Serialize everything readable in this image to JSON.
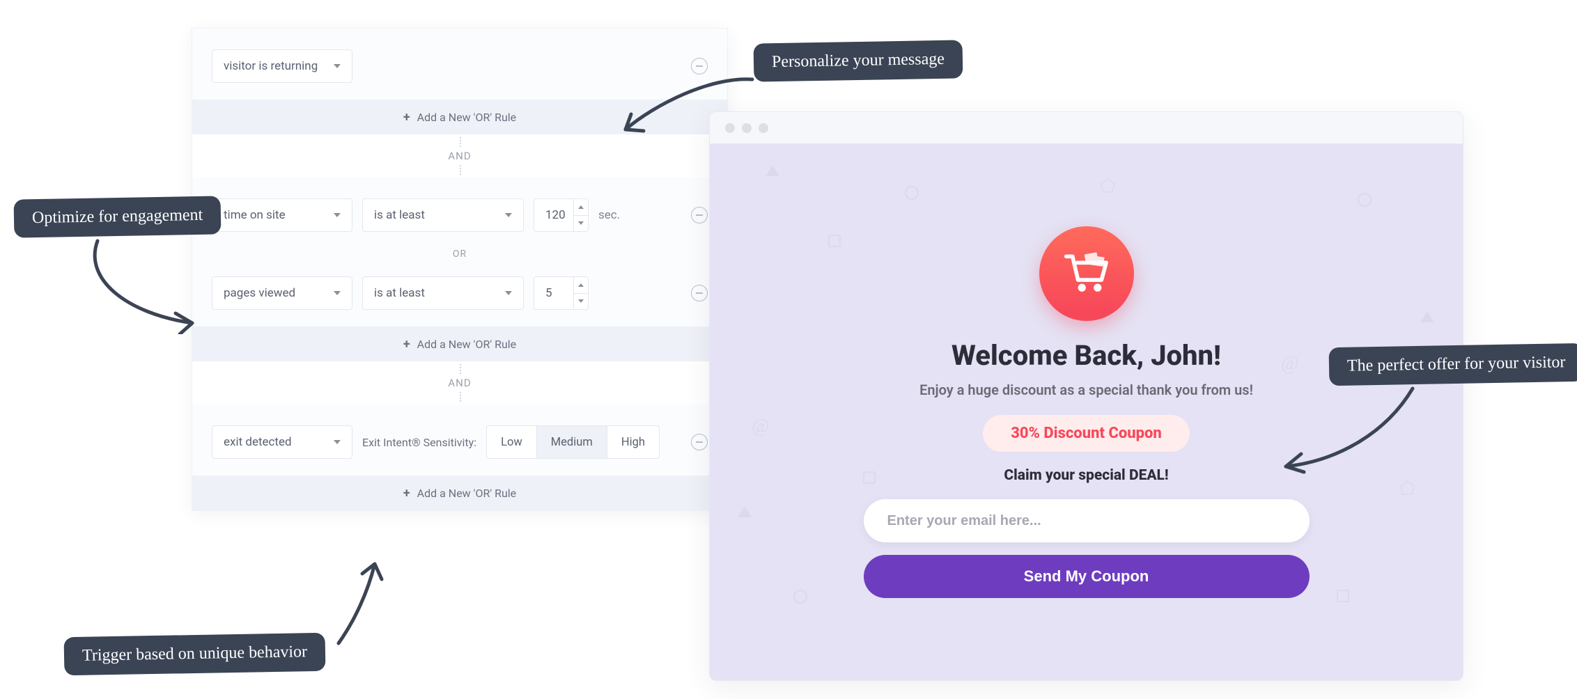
{
  "rules": {
    "block1": {
      "condition": "visitor is returning",
      "add_or_label": "Add a New 'OR' Rule"
    },
    "and_label": "AND",
    "or_label": "OR",
    "block2": {
      "row1": {
        "metric": "time on site",
        "op": "is at least",
        "value": "120",
        "unit": "sec."
      },
      "row2": {
        "metric": "pages viewed",
        "op": "is at least",
        "value": "5"
      },
      "add_or_label": "Add a New 'OR' Rule"
    },
    "block3": {
      "metric": "exit detected",
      "sensitivity_label": "Exit Intent® Sensitivity:",
      "options": {
        "low": "Low",
        "medium": "Medium",
        "high": "High"
      },
      "add_or_label": "Add a New 'OR' Rule"
    }
  },
  "popup": {
    "headline": "Welcome Back, John!",
    "subline": "Enjoy a huge discount as a special thank you from us!",
    "coupon": "30% Discount Coupon",
    "claim": "Claim your special DEAL!",
    "email_placeholder": "Enter your email here...",
    "cta": "Send My Coupon"
  },
  "callouts": {
    "personalize": "Personalize your message",
    "engagement": "Optimize for engagement",
    "trigger": "Trigger based on unique behavior",
    "offer": "The perfect offer for your visitor"
  }
}
